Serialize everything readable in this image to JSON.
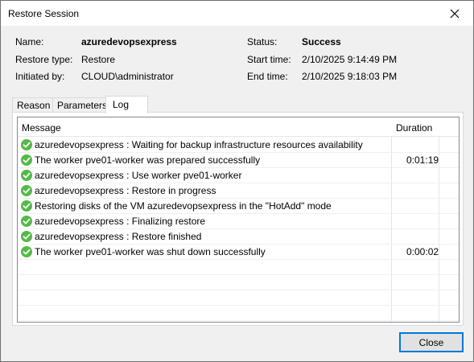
{
  "window": {
    "title": "Restore Session"
  },
  "info": {
    "name_label": "Name:",
    "name_value": "azuredevopsexpress",
    "restore_type_label": "Restore type:",
    "restore_type_value": "Restore",
    "initiated_label": "Initiated by:",
    "initiated_value": "CLOUD\\administrator",
    "status_label": "Status:",
    "status_value": "Success",
    "start_label": "Start time:",
    "start_value": "2/10/2025 9:14:49 PM",
    "end_label": "End time:",
    "end_value": "2/10/2025 9:18:03 PM"
  },
  "tabs": [
    {
      "label": "Reason"
    },
    {
      "label": "Parameters"
    },
    {
      "label": "Log",
      "active": true
    }
  ],
  "log": {
    "columns": {
      "message": "Message",
      "duration": "Duration"
    },
    "rows": [
      {
        "icon": "success-check-icon",
        "message": "azuredevopsexpress : Waiting for backup infrastructure resources availability",
        "duration": ""
      },
      {
        "icon": "success-check-icon",
        "message": "The worker pve01-worker was prepared successfully",
        "duration": "0:01:19"
      },
      {
        "icon": "success-check-icon",
        "message": "azuredevopsexpress : Use worker pve01-worker",
        "duration": ""
      },
      {
        "icon": "success-check-icon",
        "message": "azuredevopsexpress : Restore in progress",
        "duration": ""
      },
      {
        "icon": "success-check-icon",
        "message": "Restoring disks of the VM azuredevopsexpress in the \"HotAdd\" mode",
        "duration": ""
      },
      {
        "icon": "success-check-icon",
        "message": "azuredevopsexpress : Finalizing restore",
        "duration": ""
      },
      {
        "icon": "success-check-icon",
        "message": "azuredevopsexpress : Restore finished",
        "duration": ""
      },
      {
        "icon": "success-check-icon",
        "message": "The worker pve01-worker was shut down successfully",
        "duration": "0:00:02"
      }
    ]
  },
  "buttons": {
    "close_label": "Close"
  },
  "colors": {
    "success": "#54b948",
    "accent": "#0078d7"
  }
}
